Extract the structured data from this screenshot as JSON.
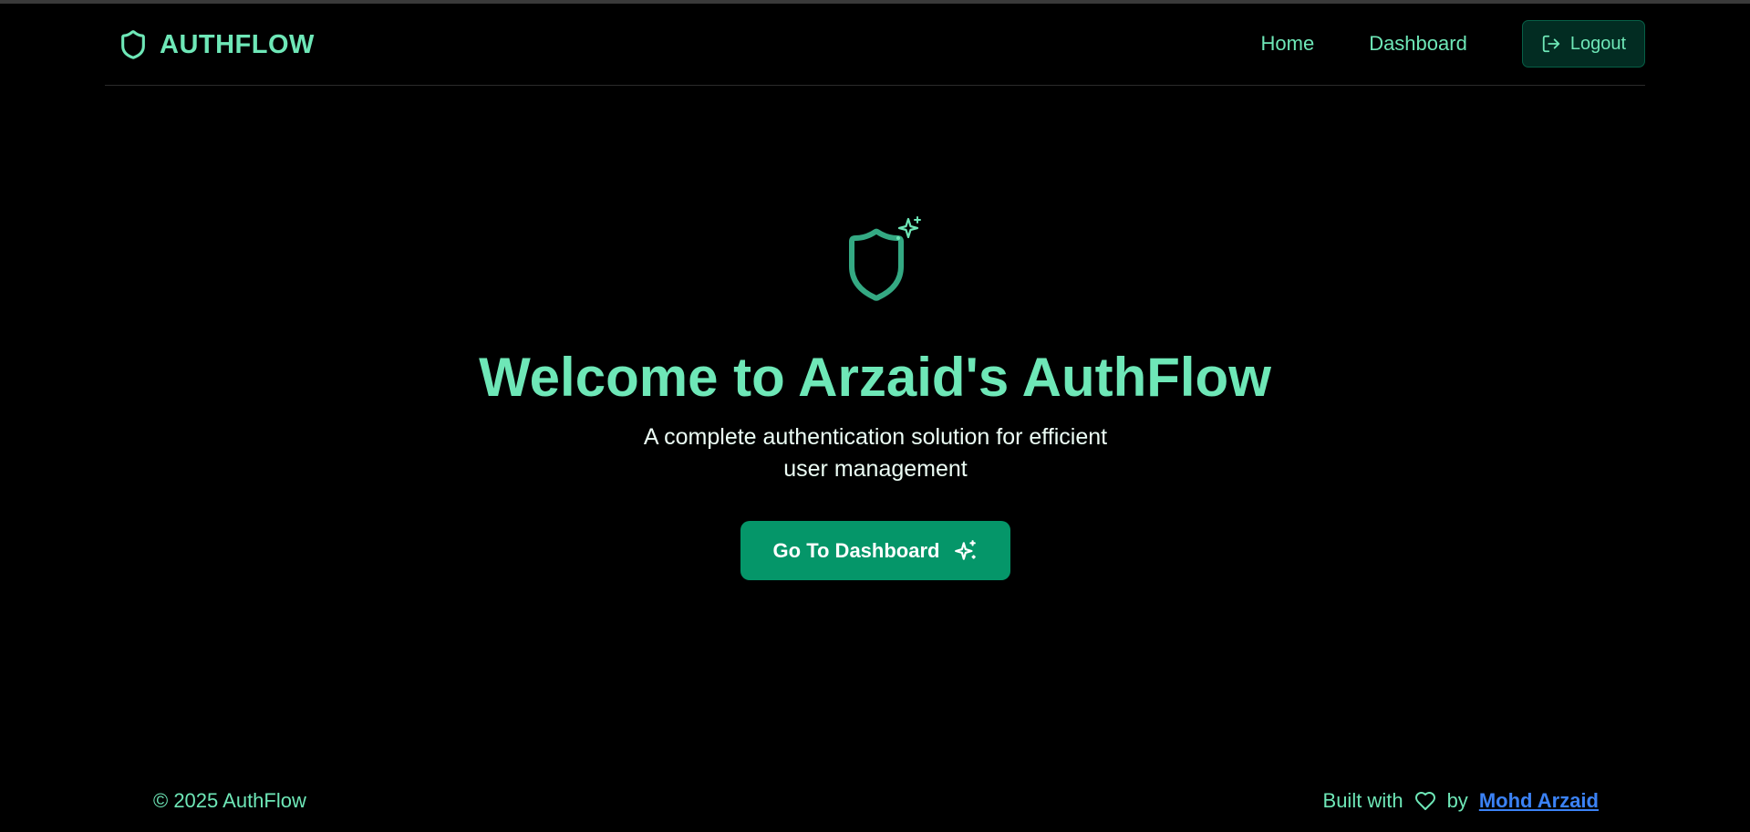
{
  "brand": {
    "name": "AUTHFLOW",
    "icon": "shield-icon"
  },
  "nav": {
    "home_label": "Home",
    "dashboard_label": "Dashboard",
    "logout_label": "Logout",
    "logout_icon": "logout-icon"
  },
  "hero": {
    "icon": "shield-sparkles-icon",
    "title": "Welcome to Arzaid's AuthFlow",
    "subtitle_line1": "A complete authentication solution for efficient",
    "subtitle_line2": "user management",
    "cta_label": "Go To Dashboard",
    "cta_icon": "sparkles-icon"
  },
  "footer": {
    "copyright": "© 2025 AuthFlow",
    "built_with": "Built with",
    "heart_icon": "heart-icon",
    "by": "by",
    "author": "Mohd Arzaid"
  },
  "colors": {
    "background": "#000000",
    "accent": "#6ee7b7",
    "button": "#059669",
    "link": "#3b82f6",
    "logout_bg": "#022c22"
  }
}
